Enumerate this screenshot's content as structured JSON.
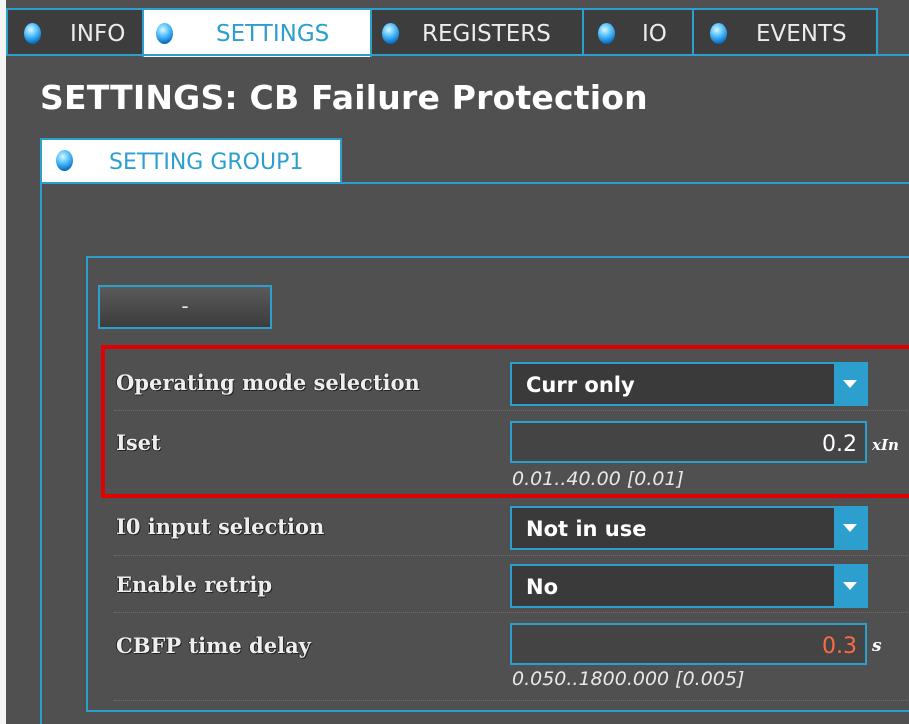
{
  "tabs": [
    {
      "label": "INFO",
      "active": false
    },
    {
      "label": "SETTINGS",
      "active": true
    },
    {
      "label": "REGISTERS",
      "active": false
    },
    {
      "label": "IO",
      "active": false
    },
    {
      "label": "EVENTS",
      "active": false
    }
  ],
  "page_title": "SETTINGS: CB Failure Protection",
  "group_tab": {
    "label": "SETTING GROUP1"
  },
  "collapse_button": {
    "label": "-"
  },
  "settings": {
    "operating_mode": {
      "label": "Operating mode selection",
      "value": "Curr only"
    },
    "iset": {
      "label": "Iset",
      "value": "0.2",
      "unit": "xIn",
      "range": "0.01..40.00 [0.01]"
    },
    "io_input": {
      "label": "I0 input selection",
      "value": "Not in use"
    },
    "enable_retrip": {
      "label": "Enable retrip",
      "value": "No"
    },
    "cbfp_delay": {
      "label": "CBFP time delay",
      "value": "0.3",
      "unit": "s",
      "range": "0.050..1800.000 [0.005]"
    }
  },
  "colors": {
    "accent": "#2c9fcf",
    "background": "#505050",
    "highlight": "#e00000",
    "warning_value": "#ff6a45"
  }
}
